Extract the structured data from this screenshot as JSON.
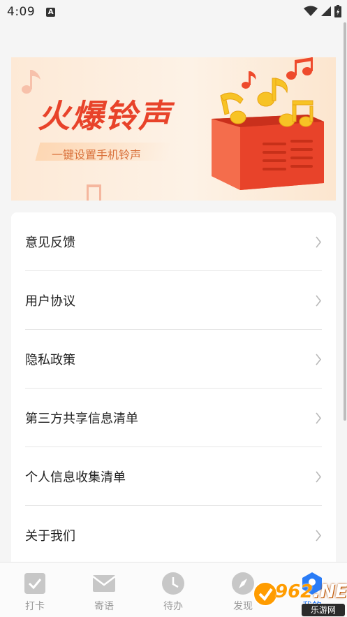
{
  "status_bar": {
    "time": "4:09",
    "notification_glyph": "A"
  },
  "banner": {
    "title": "火爆铃声",
    "subtitle": "一键设置手机铃声"
  },
  "menu": {
    "items": [
      {
        "label": "意见反馈"
      },
      {
        "label": "用户协议"
      },
      {
        "label": "隐私政策"
      },
      {
        "label": "第三方共享信息清单"
      },
      {
        "label": "个人信息收集清单"
      },
      {
        "label": "关于我们"
      }
    ]
  },
  "tabs": [
    {
      "label": "打卡",
      "icon": "check-icon"
    },
    {
      "label": "寄语",
      "icon": "mail-icon"
    },
    {
      "label": "待办",
      "icon": "clock-icon"
    },
    {
      "label": "发现",
      "icon": "compass-icon"
    },
    {
      "label": "我的",
      "icon": "profile-icon",
      "active": true
    }
  ],
  "watermark": {
    "brand": "962.NET",
    "brand_highlight": "962",
    "brand_rest": ".NET",
    "sub": "乐游网"
  },
  "colors": {
    "accent": "#2a7cf6",
    "banner_title": "#e8432a",
    "tab_inactive": "#9a9a9a"
  }
}
